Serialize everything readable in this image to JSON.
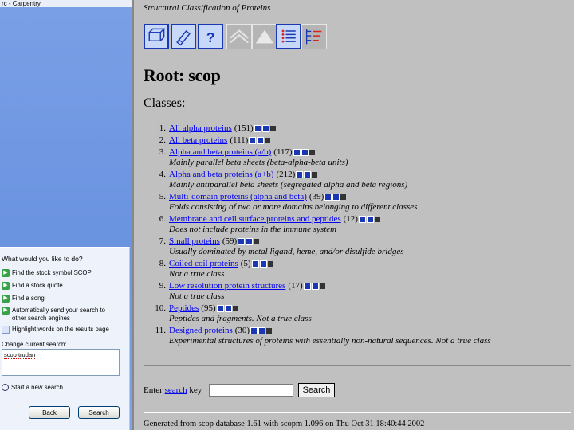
{
  "pane": {
    "title": "rc - Carpentry",
    "prompt": "What would you like to do?",
    "options": [
      {
        "icon": "arrow-icon",
        "label": "Find the stock symbol SCOP"
      },
      {
        "icon": "arrow-icon",
        "label": "Find a stock quote"
      },
      {
        "icon": "arrow-icon",
        "label": "Find a song"
      },
      {
        "icon": "arrow-icon",
        "label": "Automatically send your search to other search engines"
      },
      {
        "icon": "highlight-icon",
        "label": "Highlight words on the results page"
      }
    ],
    "change_label": "Change current search:",
    "search_value": "scop ",
    "search_value_2": "trudan",
    "new_search": "Start a new search",
    "back_label": "Back",
    "search_label": "Search"
  },
  "page": {
    "header": "Structural Classification of Proteins",
    "root_title": "Root: scop",
    "classes_title": "Classes:",
    "classes": [
      {
        "num": "1.",
        "name": "All alpha proteins",
        "count": "(151)",
        "desc": ""
      },
      {
        "num": "2.",
        "name": "All beta proteins",
        "count": "(111)",
        "desc": ""
      },
      {
        "num": "3.",
        "name": "Alpha and beta proteins (a/b)",
        "count": "(117)",
        "desc": "Mainly parallel beta sheets (beta-alpha-beta units)"
      },
      {
        "num": "4.",
        "name": "Alpha and beta proteins (a+b)",
        "count": "(212)",
        "desc": "Mainly antiparallel beta sheets (segregated alpha and beta regions)"
      },
      {
        "num": "5.",
        "name": "Multi-domain proteins (alpha and beta)",
        "count": "(39)",
        "desc": "Folds consisting of two or more domains belonging to different classes"
      },
      {
        "num": "6.",
        "name": "Membrane and cell surface proteins and peptides",
        "count": "(12)",
        "desc": "Does not include proteins in the immune system"
      },
      {
        "num": "7.",
        "name": "Small proteins",
        "count": "(59)",
        "desc": "Usually dominated by metal ligand, heme, and/or disulfide bridges"
      },
      {
        "num": "8.",
        "name": "Coiled coil proteins",
        "count": "(5)",
        "desc": "Not a true class"
      },
      {
        "num": "9.",
        "name": "Low resolution protein structures",
        "count": "(17)",
        "desc": "Not a true class"
      },
      {
        "num": "10.",
        "name": "Peptides",
        "count": "(95)",
        "desc": "Peptides and fragments. Not a true class"
      },
      {
        "num": "11.",
        "name": "Designed proteins",
        "count": "(30)",
        "desc": "Experimental structures of proteins with essentially non-natural sequences. Not a true class"
      }
    ],
    "enter_prefix": "Enter",
    "enter_link": "search",
    "enter_suffix": "key",
    "search_button": "Search",
    "footer": "Generated from scop database 1.61 with scopm 1.096 on Thu Oct 31 18:40:44 2002"
  },
  "colors": {
    "pane_blue": "#7aa0e6",
    "page_bg": "#c0c0c0",
    "link": "#0000ee",
    "toolbar_blue": "#1a37b5"
  }
}
